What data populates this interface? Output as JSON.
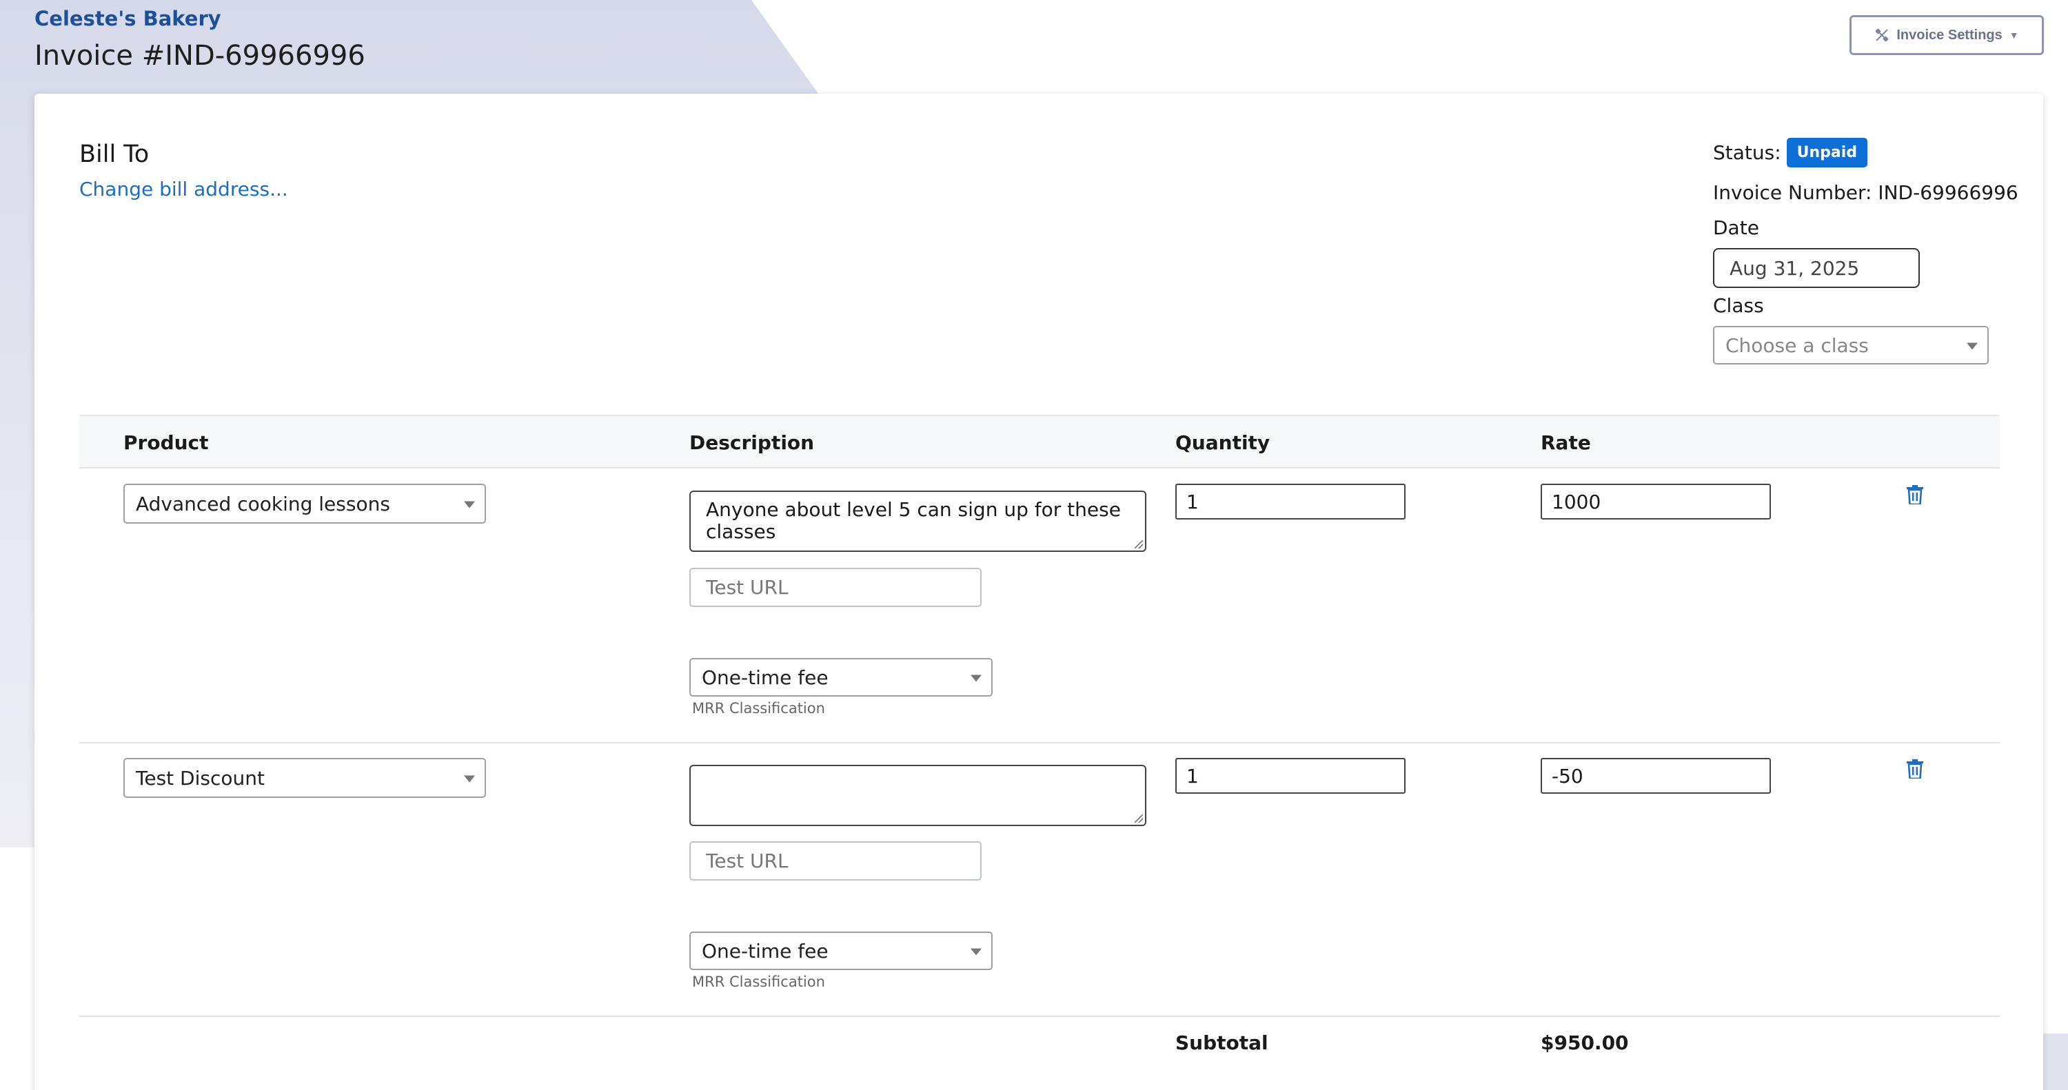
{
  "header": {
    "brand": "Celeste's Bakery",
    "title": "Invoice #IND-69966996",
    "settings_button": "Invoice Settings"
  },
  "bill_to": {
    "heading": "Bill To",
    "change_link": "Change bill address..."
  },
  "meta": {
    "status_label": "Status:",
    "status_value": "Unpaid",
    "invoice_number": "Invoice Number: IND-69966996",
    "date_label": "Date",
    "date_value": "Aug 31, 2025",
    "class_label": "Class",
    "class_placeholder": "Choose a class"
  },
  "table": {
    "columns": [
      "Product",
      "Description",
      "Quantity",
      "Rate"
    ],
    "rows": [
      {
        "product": "Advanced cooking lessons",
        "description": "Anyone about level 5 can sign up for these classes",
        "url_placeholder": "Test URL",
        "fee_type": "One-time fee",
        "mrr_label": "MRR Classification",
        "quantity": "1",
        "rate": "1000"
      },
      {
        "product": "Test Discount",
        "description": "",
        "url_placeholder": "Test URL",
        "fee_type": "One-time fee",
        "mrr_label": "MRR Classification",
        "quantity": "1",
        "rate": "-50"
      }
    ]
  },
  "totals": {
    "subtotal_label": "Subtotal",
    "subtotal_value": "$950.00"
  },
  "colors": {
    "brand": "#1d4f9a",
    "link": "#1a6fc2",
    "badge": "#0e6fd6",
    "trash": "#1a6fc2"
  }
}
